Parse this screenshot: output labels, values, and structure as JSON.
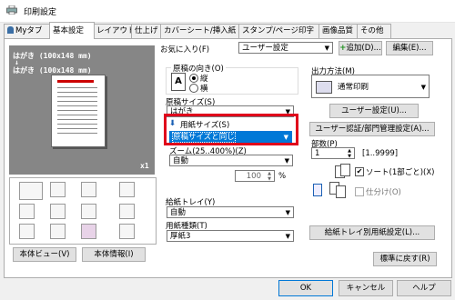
{
  "window": {
    "title": "印刷設定"
  },
  "tabs": [
    {
      "label": "Myタブ"
    },
    {
      "label": "基本設定"
    },
    {
      "label": "レイアウト"
    },
    {
      "label": "仕上げ"
    },
    {
      "label": "カバーシート/挿入紙"
    },
    {
      "label": "スタンプ/ページ印字"
    },
    {
      "label": "画像品質"
    },
    {
      "label": "その他"
    }
  ],
  "preview": {
    "line1": "はがき (100x148 mm)",
    "arrow": "↓",
    "line2": "はがき (100x148 mm)",
    "copies": "x1"
  },
  "favorites": {
    "label": "お気に入り(F)",
    "value": "ユーザー設定",
    "add": "追加(D)...",
    "edit": "編集(E)..."
  },
  "orientation": {
    "label": "原稿の向き(O)",
    "portrait": "縦",
    "landscape": "横"
  },
  "original_size": {
    "label": "原稿サイズ(S)",
    "value": "はがき"
  },
  "paper_size": {
    "label": "用紙サイズ(S)",
    "value": "原稿サイズと同じ"
  },
  "zoom": {
    "label": "ズーム(25..400%)(Z)",
    "value": "自動",
    "number": "100",
    "unit": "%"
  },
  "tray": {
    "label": "給紙トレイ(Y)",
    "value": "自動"
  },
  "paper_type": {
    "label": "用紙種類(T)",
    "value": "厚紙3"
  },
  "tray_paper_button": "給紙トレイ別用紙設定(L)...",
  "output": {
    "label": "出力方法(M)",
    "value": "通常印刷",
    "user_settings": "ユーザー設定(U)...",
    "auth": "ユーザー認証/部門管理設定(A)..."
  },
  "copies": {
    "label": "部数(P)",
    "value": "1",
    "range": "[1..9999]",
    "collate_label": "ソート(1部ごと)(X)",
    "offset_label": "仕分け(O)",
    "collate_checked": "✔"
  },
  "bottom": {
    "view": "本体ビュー(V)",
    "info": "本体情報(I)",
    "defaults": "標準に戻す(R)"
  },
  "dialog": {
    "ok": "OK",
    "cancel": "キャンセル",
    "help": "ヘルプ"
  }
}
